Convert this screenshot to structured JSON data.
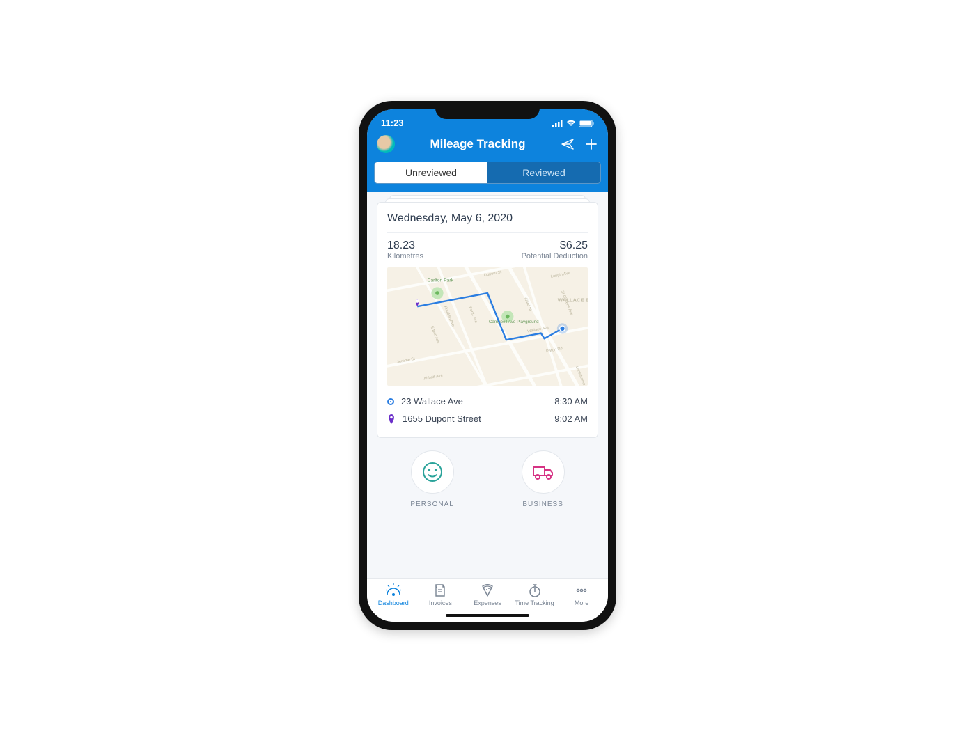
{
  "status_bar": {
    "time": "11:23"
  },
  "header": {
    "title": "Mileage Tracking"
  },
  "segments": {
    "unreviewed": "Unreviewed",
    "reviewed": "Reviewed"
  },
  "trip": {
    "date": "Wednesday, May 6, 2020",
    "distance_value": "18.23",
    "distance_label": "Kilometres",
    "deduction_value": "$6.25",
    "deduction_label": "Potential Deduction",
    "map_labels": {
      "park1": "Carlton Park",
      "park2": "Campbell Ave Playground",
      "neighborhood": "WALLACE EMERSON",
      "street1": "Dupont St",
      "street2": "Wallace Ave",
      "street3": "Paton Rd",
      "street4": "Lappin Ave",
      "street5": "St Clarens Ave",
      "street6": "Franklin Ave",
      "street7": "Edwin Ave",
      "street8": "Perth Ave",
      "street9": "Ward St",
      "street10": "Jerome St",
      "street11": "Abbott Ave",
      "street12": "Lansdowne"
    },
    "stops": {
      "origin_addr": "23 Wallace Ave",
      "origin_time": "8:30 AM",
      "dest_addr": "1655 Dupont Street",
      "dest_time": "9:02 AM"
    }
  },
  "categories": {
    "personal": "PERSONAL",
    "business": "BUSINESS"
  },
  "tabbar": {
    "dashboard": "Dashboard",
    "invoices": "Invoices",
    "expenses": "Expenses",
    "time": "Time Tracking",
    "more": "More"
  }
}
